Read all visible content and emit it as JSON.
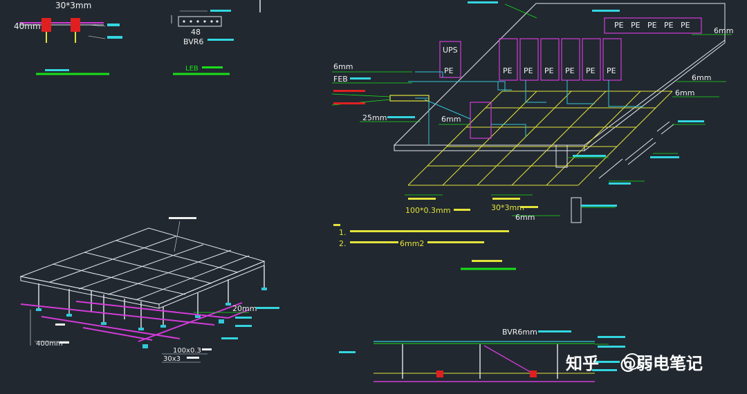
{
  "colors": {
    "background": "#212830",
    "line": "#e8e8f0",
    "magenta": "#d23cd8",
    "yellow": "#e4e43a",
    "cyan": "#33c8d8",
    "green": "#18e018",
    "red": "#e02020",
    "label_white": "#f0f0f0",
    "label_cyan": "#33d6e0"
  },
  "top_left": {
    "dim_top": "30*3mm",
    "dim_left": "40mm",
    "title_bar": "LEB",
    "bvr_label": "BVR6",
    "bolt_label": "48"
  },
  "right_legend": {
    "ups": "UPS",
    "pe": "PE",
    "feb": "FEB",
    "cable_6mm": "6mm",
    "cable_25mm": "25mm",
    "strip_100": "100*0.3mm",
    "strip_30": "30*3mm",
    "cable_6mm_b": "6mm"
  },
  "notes": {
    "n1_prefix": "1.",
    "n2_prefix": "2.",
    "n2_size": "6mm2"
  },
  "bottom_left": {
    "dim_20mm": "20mm",
    "dim_400mm": "400mm",
    "dim_100": "100x0.3",
    "dim_30": "30x3"
  },
  "bottom_right": {
    "bvr_label": "BVR6mm"
  },
  "watermark": {
    "platform": "知乎",
    "author": "@弱电笔记"
  }
}
